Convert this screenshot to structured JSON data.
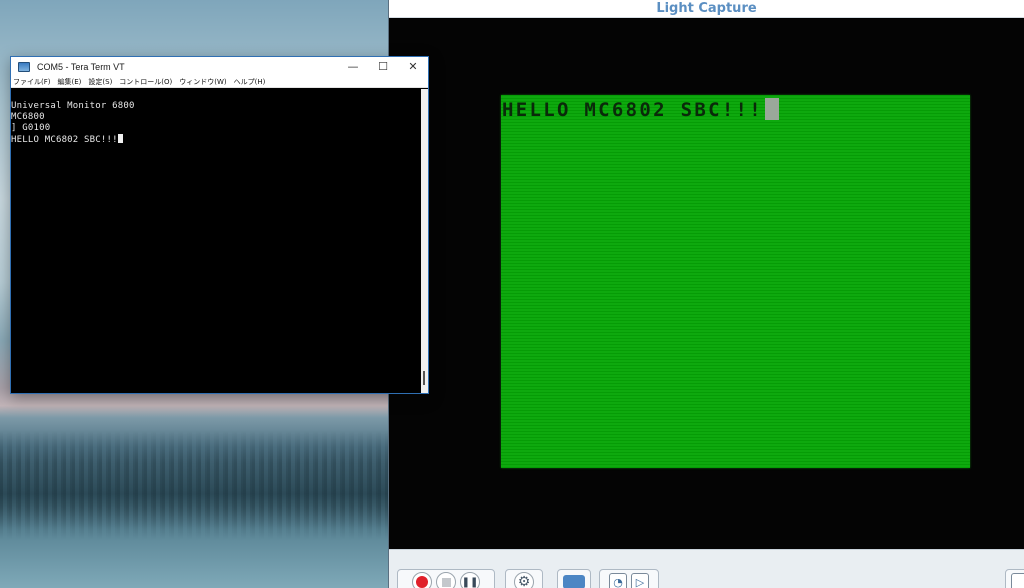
{
  "light_capture": {
    "title": "Light Capture",
    "screen_text": "HELLO MC6802 SBC!!!",
    "toolbar": {
      "icons": [
        "record-icon",
        "stop-icon",
        "pause-icon",
        "settings-icon",
        "capture-icon",
        "snapshot-icon",
        "play-icon",
        "fullscreen-icon"
      ]
    }
  },
  "tera_term": {
    "title": "COM5 - Tera Term VT",
    "controls": {
      "minimize": "—",
      "maximize": "☐",
      "close": "✕"
    },
    "menu": [
      "ファイル(F)",
      "編集(E)",
      "設定(S)",
      "コントロール(O)",
      "ウィンドウ(W)",
      "ヘルプ(H)"
    ],
    "lines": [
      "Universal Monitor 6800",
      "MC6800",
      "] G0100",
      "HELLO MC6802 SBC!!!"
    ]
  },
  "colors": {
    "crt_green": "#06a606",
    "lc_title": "#5b8fc2",
    "record_red": "#e0202a"
  }
}
